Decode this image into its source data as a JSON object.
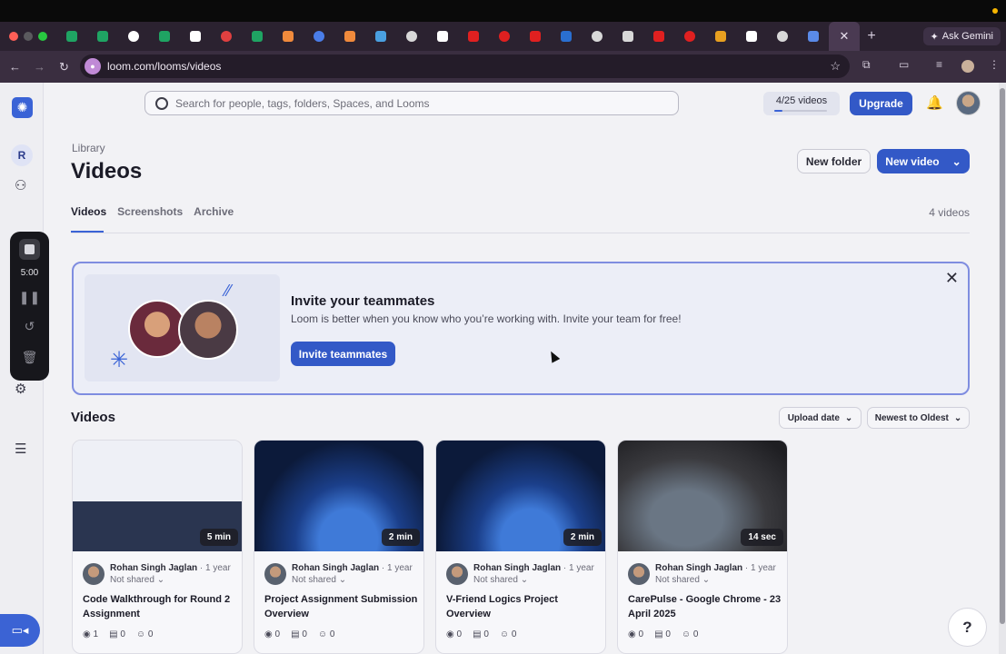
{
  "browser": {
    "url": "loom.com/looms/videos",
    "gemini_label": "Ask Gemini",
    "tab_colors": [
      "#1fa463",
      "#1fa463",
      "#ffffff",
      "#1fa463",
      "#ffffff",
      "#e04040",
      "#1fa463",
      "#f08a3c",
      "#4a7de8",
      "#f08a3c",
      "#4aa0e0",
      "#d8d8d8",
      "#ffffff",
      "#e02020",
      "#e02020",
      "#e02020",
      "#2a6fd0",
      "#d8d8d8",
      "#d8d8d8",
      "#e02020",
      "#e02020",
      "#e8a020",
      "#ffffff",
      "#d8d8d8",
      "#5a8ae8"
    ]
  },
  "header": {
    "search_placeholder": "Search for people, tags, folders, Spaces, and Looms",
    "usage_label": "4/25 videos",
    "usage_fraction": 0.16,
    "upgrade_label": "Upgrade"
  },
  "sidebar": {
    "avatar_initial": "R",
    "recorder_time": "5:00"
  },
  "page": {
    "breadcrumb": "Library",
    "title": "Videos",
    "new_folder": "New folder",
    "new_video": "New video",
    "tabs": [
      "Videos",
      "Screenshots",
      "Archive"
    ],
    "count": "4 videos"
  },
  "invite": {
    "title": "Invite your teammates",
    "body": "Loom is better when you know who you’re working with. Invite your team for free!",
    "button": "Invite teammates"
  },
  "videos_section": {
    "title": "Videos",
    "sort_field": "Upload date",
    "sort_order": "Newest to Oldest"
  },
  "videos": [
    {
      "duration": "5 min",
      "author": "Rohan Singh Jaglan",
      "age": "· 1 year",
      "sharing": "Not shared",
      "title": "Code Walkthrough for Round 2 Assignment",
      "views": "1",
      "comments": "0",
      "reactions": "0"
    },
    {
      "duration": "2 min",
      "author": "Rohan Singh Jaglan",
      "age": "· 1 year",
      "sharing": "Not shared",
      "title": "Project Assignment Submission Overview",
      "views": "0",
      "comments": "0",
      "reactions": "0"
    },
    {
      "duration": "2 min",
      "author": "Rohan Singh Jaglan",
      "age": "· 1 year",
      "sharing": "Not shared",
      "title": "V-Friend Logics Project Overview",
      "views": "0",
      "comments": "0",
      "reactions": "0"
    },
    {
      "duration": "14 sec",
      "author": "Rohan Singh Jaglan",
      "age": "· 1 year",
      "sharing": "Not shared",
      "title": "CarePulse - Google Chrome - 23 April 2025",
      "views": "0",
      "comments": "0",
      "reactions": "0"
    }
  ],
  "help_label": "?",
  "colors": {
    "accent": "#3359c7",
    "invite_border": "#7f8de0"
  }
}
